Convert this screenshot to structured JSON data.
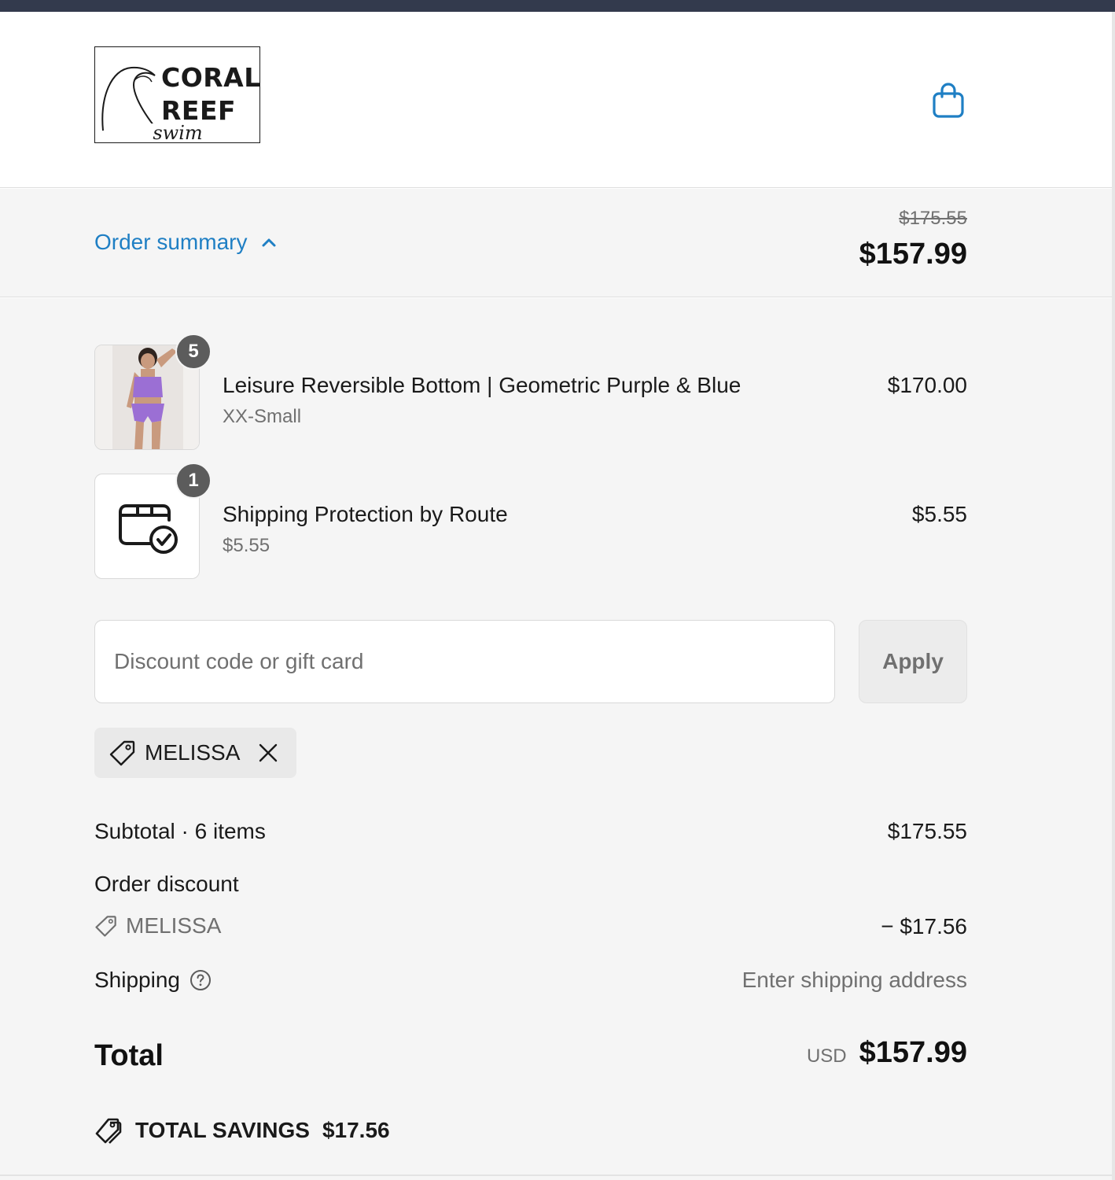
{
  "brand": {
    "logo_line1": "CORAL",
    "logo_line2": "REEF",
    "logo_script": "swim"
  },
  "header": {
    "cart_icon": "shopping-bag-icon"
  },
  "summary": {
    "toggle_label": "Order summary",
    "toggle_icon": "chevron-up-icon",
    "original_total": "$175.55",
    "total": "$157.99"
  },
  "line_items": [
    {
      "title": "Leisure Reversible Bottom | Geometric Purple & Blue",
      "variant": "XX-Small",
      "price": "$170.00",
      "quantity": "5"
    },
    {
      "title": "Shipping Protection by Route",
      "variant": "$5.55",
      "price": "$5.55",
      "quantity": "1",
      "icon": "package-check-icon"
    }
  ],
  "discount": {
    "placeholder": "Discount code or gift card",
    "value": "",
    "apply_label": "Apply",
    "applied_code": "MELISSA"
  },
  "totals": {
    "subtotal_label": "Subtotal · 6 items",
    "subtotal_value": "$175.55",
    "order_discount_label": "Order discount",
    "order_discount_code": "MELISSA",
    "order_discount_value": "− $17.56",
    "shipping_label": "Shipping",
    "shipping_value": "Enter shipping address",
    "total_label": "Total",
    "currency": "USD",
    "total_value": "$157.99",
    "savings_label": "TOTAL SAVINGS",
    "savings_value": "$17.56"
  },
  "colors": {
    "accent": "#1f7fc4",
    "top_bar": "#333a4d",
    "panel_bg": "#f5f5f5",
    "badge": "#5c5c5c",
    "muted_text": "#707070"
  }
}
